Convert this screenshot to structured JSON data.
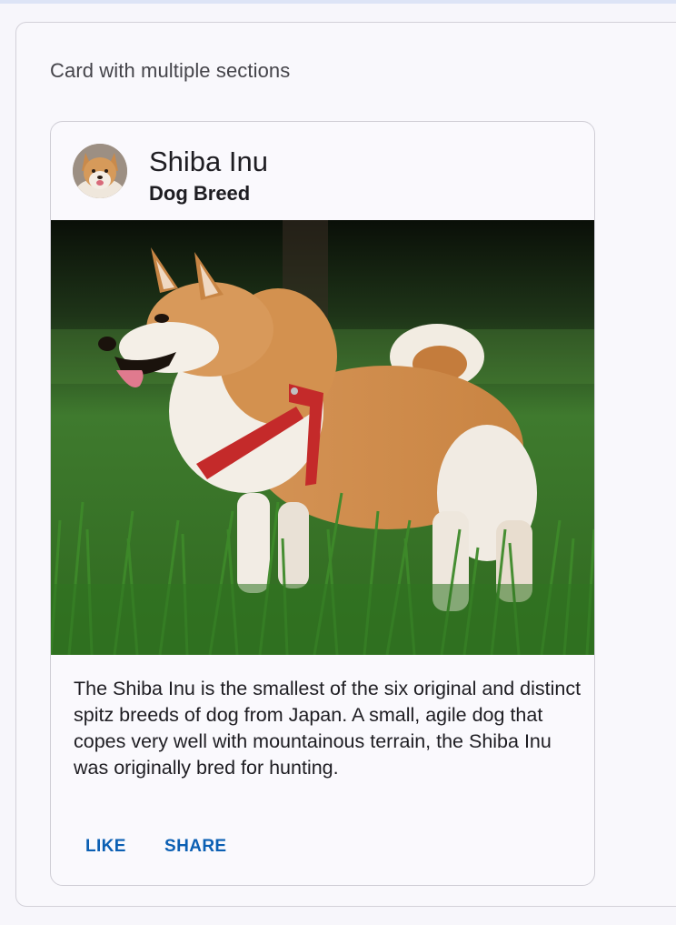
{
  "section": {
    "title": "Card with multiple sections"
  },
  "card": {
    "title": "Shiba Inu",
    "subtitle": "Dog Breed",
    "avatar_icon": "shiba-inu-avatar",
    "media_alt": "Shiba Inu standing in grass",
    "body": "The Shiba Inu is the smallest of the six original and distinct spitz breeds of dog from Japan. A small, agile dog that copes very well with mountainous terrain, the Shiba Inu was originally bred for hunting.",
    "actions": {
      "like_label": "LIKE",
      "share_label": "SHARE"
    }
  },
  "colors": {
    "accent": "#0b5fb3",
    "top_strip": "#dde4f6"
  }
}
